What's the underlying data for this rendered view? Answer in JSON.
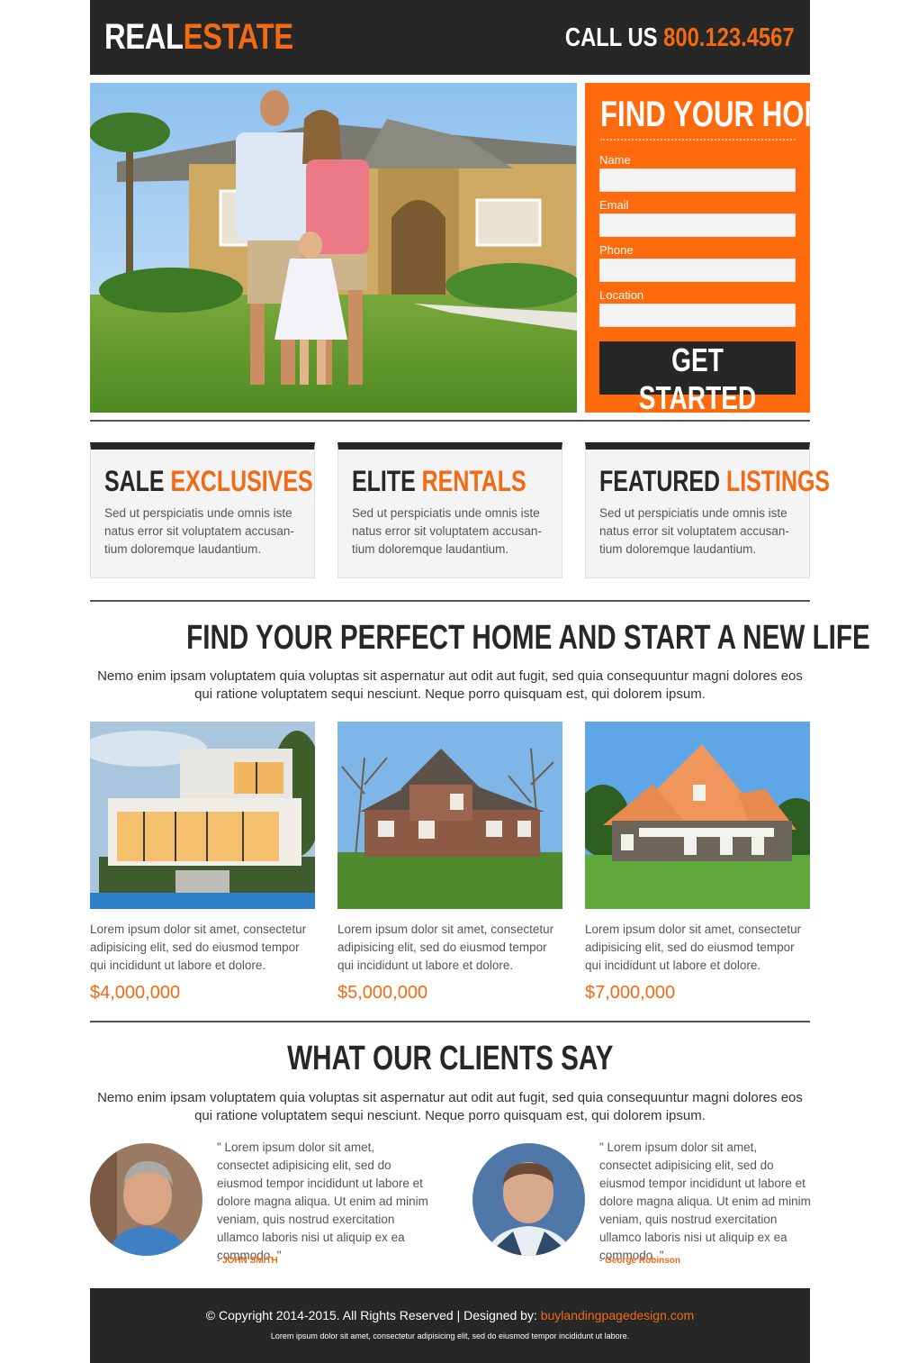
{
  "header": {
    "logo_part1": "REAL",
    "logo_part2": "ESTATE",
    "call_label": "CALL US",
    "phone": "800.123.4567"
  },
  "form": {
    "title": "FIND YOUR HOME",
    "fields": [
      {
        "label": "Name",
        "value": ""
      },
      {
        "label": "Email",
        "value": ""
      },
      {
        "label": "Phone",
        "value": ""
      },
      {
        "label": "Location",
        "value": ""
      }
    ],
    "submit_label": "GET STARTED"
  },
  "features": [
    {
      "title_dark": "SALE",
      "title_orange": "EXCLUSIVES",
      "text": "Sed ut perspiciatis unde omnis iste natus error sit voluptatem accusan-tium doloremque laudantium."
    },
    {
      "title_dark": "ELITE",
      "title_orange": "RENTALS",
      "text": "Sed ut perspiciatis unde omnis iste natus error sit voluptatem accusan-tium doloremque laudantium."
    },
    {
      "title_dark": "FEATURED",
      "title_orange": "LISTINGS",
      "text": "Sed ut perspiciatis unde omnis iste natus error sit voluptatem accusan-tium doloremque laudantium."
    }
  ],
  "perfect_home": {
    "title": "FIND YOUR PERFECT HOME AND START A NEW LIFE",
    "text": "Nemo enim ipsam voluptatem quia voluptas sit aspernatur aut odit aut fugit, sed quia consequuntur magni dolores eos qui ratione voluptatem sequi nesciunt. Neque porro quisquam est, qui dolorem ipsum."
  },
  "listings": [
    {
      "desc": "Lorem ipsum dolor sit amet, consectetur adipisicing elit, sed do eiusmod tempor qui incididunt ut labore et dolore.",
      "price": "$4,000,000"
    },
    {
      "desc": "Lorem ipsum dolor sit amet, consectetur adipisicing elit, sed do eiusmod tempor qui incididunt ut labore et dolore.",
      "price": "$5,000,000"
    },
    {
      "desc": "Lorem ipsum dolor sit amet, consectetur adipisicing elit, sed do eiusmod tempor qui incididunt ut labore et dolore.",
      "price": "$7,000,000"
    }
  ],
  "clients": {
    "title": "WHAT OUR CLIENTS SAY",
    "text": "Nemo enim ipsam voluptatem quia voluptas sit aspernatur aut odit aut fugit, sed quia consequuntur magni dolores eos qui ratione voluptatem sequi nesciunt. Neque porro quisquam est, qui dolorem ipsum.",
    "testimonials": [
      {
        "quote": "\" Lorem ipsum dolor sit amet, consectet adipisicing elit, sed do eiusmod tempor incididunt ut labore et dolore magna aliqua. Ut enim ad minim veniam, quis nostrud exercitation ullamco laboris nisi ut aliquip ex ea commodo. \"",
        "author": "- JOHN SMITH"
      },
      {
        "quote": "\" Lorem ipsum dolor sit amet, consectet adipisicing elit, sed do eiusmod tempor incididunt ut labore et dolore magna aliqua. Ut enim ad minim veniam, quis nostrud exercitation ullamco laboris nisi ut aliquip ex ea commodo. \"",
        "author": "- George Robinson"
      }
    ]
  },
  "footer": {
    "copyright": "© Copyright 2014-2015. All Rights Reserved  |  Designed by:",
    "designer_link": "buylandingpagedesign.com",
    "small_text": "Lorem ipsum dolor sit amet, consectetur adipisicing elit, sed do eiusmod tempor incididunt ut labore."
  },
  "colors": {
    "accent": "#f26a13",
    "dark": "#272727",
    "form_bg": "#ff6a0d"
  }
}
